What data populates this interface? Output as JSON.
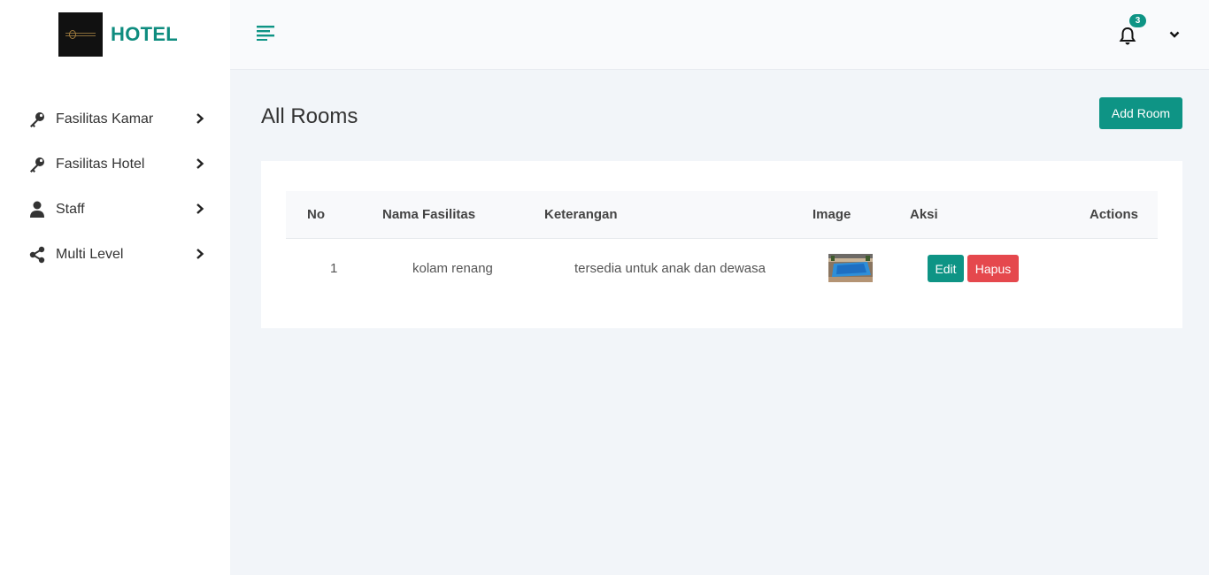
{
  "brand": {
    "name": "HOTEL"
  },
  "sidebar": {
    "items": [
      {
        "label": "Fasilitas Kamar",
        "icon": "key-icon"
      },
      {
        "label": "Fasilitas Hotel",
        "icon": "key-icon"
      },
      {
        "label": "Staff",
        "icon": "user-icon"
      },
      {
        "label": "Multi Level",
        "icon": "share-icon"
      }
    ]
  },
  "topbar": {
    "notification_count": "3"
  },
  "main": {
    "title": "All Rooms",
    "add_button": "Add Room",
    "table": {
      "headers": [
        "No",
        "Nama Fasilitas",
        "Keterangan",
        "Image",
        "Aksi",
        "Actions"
      ],
      "rows": [
        {
          "no": "1",
          "nama": "kolam renang",
          "keterangan": "tersedia untuk anak dan dewasa",
          "edit": "Edit",
          "hapus": "Hapus"
        }
      ]
    }
  },
  "colors": {
    "accent": "#0e9485",
    "danger": "#e5484d",
    "background": "#f2f5f9"
  }
}
